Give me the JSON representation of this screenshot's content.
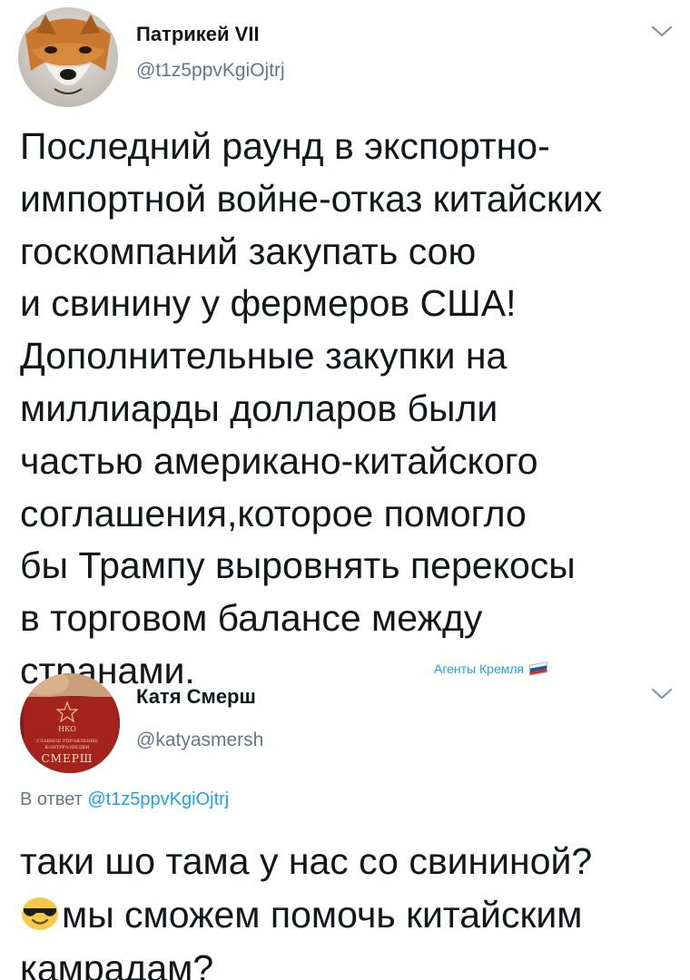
{
  "tweets": [
    {
      "author": {
        "name": "Патрикей VII",
        "handle": "@t1z5ppvKgiOjtrj",
        "avatar_icon": "fox-avatar-icon"
      },
      "text_lines": [
        "Последний раунд в экспортно-",
        "импортной войне-отказ китайских",
        "госкомпаний закупать сою",
        "и свинину у фермеров США!",
        "Дополнительные закупки на",
        "миллиарды долларов были",
        "частью американо-китайского",
        "соглашения,которое помогло",
        "бы Трампу выровнять перекосы",
        "в торговом балансе между",
        "странами."
      ]
    },
    {
      "author": {
        "name": "Катя Смерш",
        "handle": "@katyasmersh",
        "avatar_icon": "smersh-id-card-avatar-icon",
        "avatar_text": {
          "line1": "НКО",
          "line2": "ГЛАВНОЕ УПРАВЛЕНИЕ",
          "line3": "КОНТРРАЗВЕДКИ",
          "line4": "СМЕРШ"
        }
      },
      "reply_prefix": "В ответ",
      "reply_mention": "@t1z5ppvKgiOjtrj",
      "text_lines": [
        "таки шо тама у нас со свининой?",
        "мы сможем помочь китайским",
        "камрадам?"
      ],
      "emoji": "smiling-face-with-sunglasses-icon"
    }
  ],
  "watermark": {
    "label": "Агенты Кремля",
    "flag_icon": "russian-flag-icon"
  },
  "colors": {
    "text": "#14171a",
    "secondary": "#657786",
    "link": "#1da1f2"
  }
}
